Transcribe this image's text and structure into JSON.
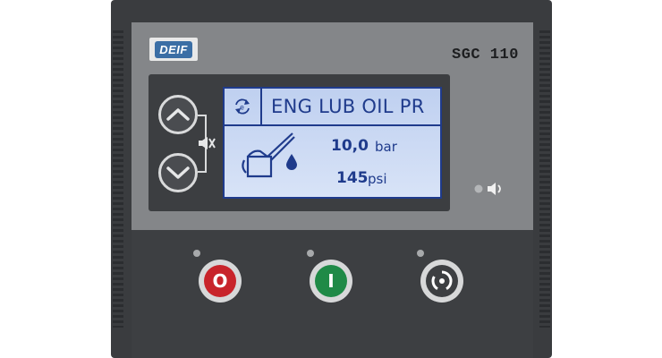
{
  "device": {
    "brand_logo": "DEIF",
    "model": "SGC 110"
  },
  "display": {
    "title": "ENG LUB OIL PR",
    "reading_primary": {
      "value": "10,0",
      "unit": "bar"
    },
    "reading_secondary": {
      "value": "145",
      "unit": "psi"
    },
    "icons": [
      "auto-scroll-icon",
      "oil-can-icon",
      "oil-drop-icon"
    ]
  },
  "buttons": {
    "up": "chevron-up-icon",
    "down": "chevron-down-icon",
    "stop_label": "O",
    "start_label": "I",
    "mode": "rotation-icon"
  },
  "colors": {
    "lcd_text": "#1f3b8c",
    "lcd_background": "#cddbf4",
    "stop": "#c8242b",
    "start": "#1f8a47",
    "logo": "#3b6ea5"
  }
}
